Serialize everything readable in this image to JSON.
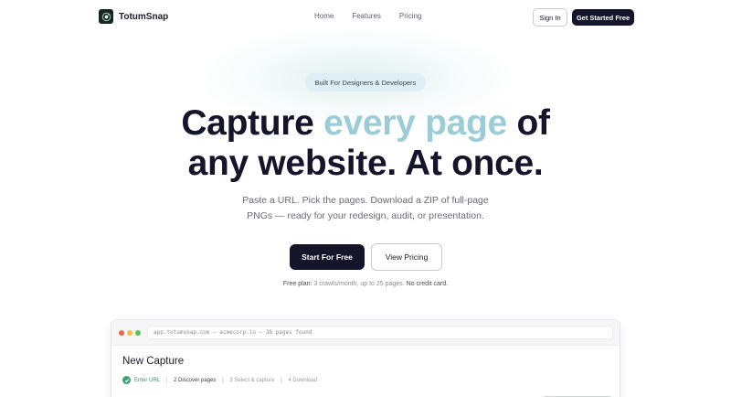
{
  "nav": {
    "brand": "TotumSnap",
    "links": [
      "Home",
      "Features",
      "Pricing"
    ],
    "sign_in": "Sign In",
    "get_started": "Get Started Free"
  },
  "hero": {
    "badge": "Built For Designers & Developers",
    "headline_part1": "Capture ",
    "headline_accent": "every page",
    "headline_part2": " of",
    "headline_line2": "any website. At once.",
    "subtitle_line1": "Paste a URL. Pick the pages. Download a ZIP of full-page",
    "subtitle_line2": "PNGs — ready for your redesign, audit, or presentation.",
    "cta_primary": "Start For Free",
    "cta_secondary": "View Pricing",
    "free_label": "Free plan:",
    "free_detail": " 3 crawls/month, up to 25 pages. ",
    "free_nocard": "No credit card."
  },
  "app_window": {
    "url_text": "app.totumsnap.com — acmecorp.io — 38 pages found",
    "title": "New Capture",
    "steps": [
      {
        "label": "Enter URL",
        "state": "done"
      },
      {
        "label": "2 Discover pages",
        "state": "active"
      },
      {
        "label": "3 Select & capture",
        "state": "pending"
      },
      {
        "label": "4 Download",
        "state": "pending"
      }
    ]
  },
  "colors": {
    "primary_dark": "#14142a",
    "accent": "#9ccdd6",
    "badge_bg": "#dfeef4",
    "success": "#3f9f72"
  },
  "icons": {
    "logo": "camera-aperture-icon",
    "step_done": "check-icon"
  }
}
